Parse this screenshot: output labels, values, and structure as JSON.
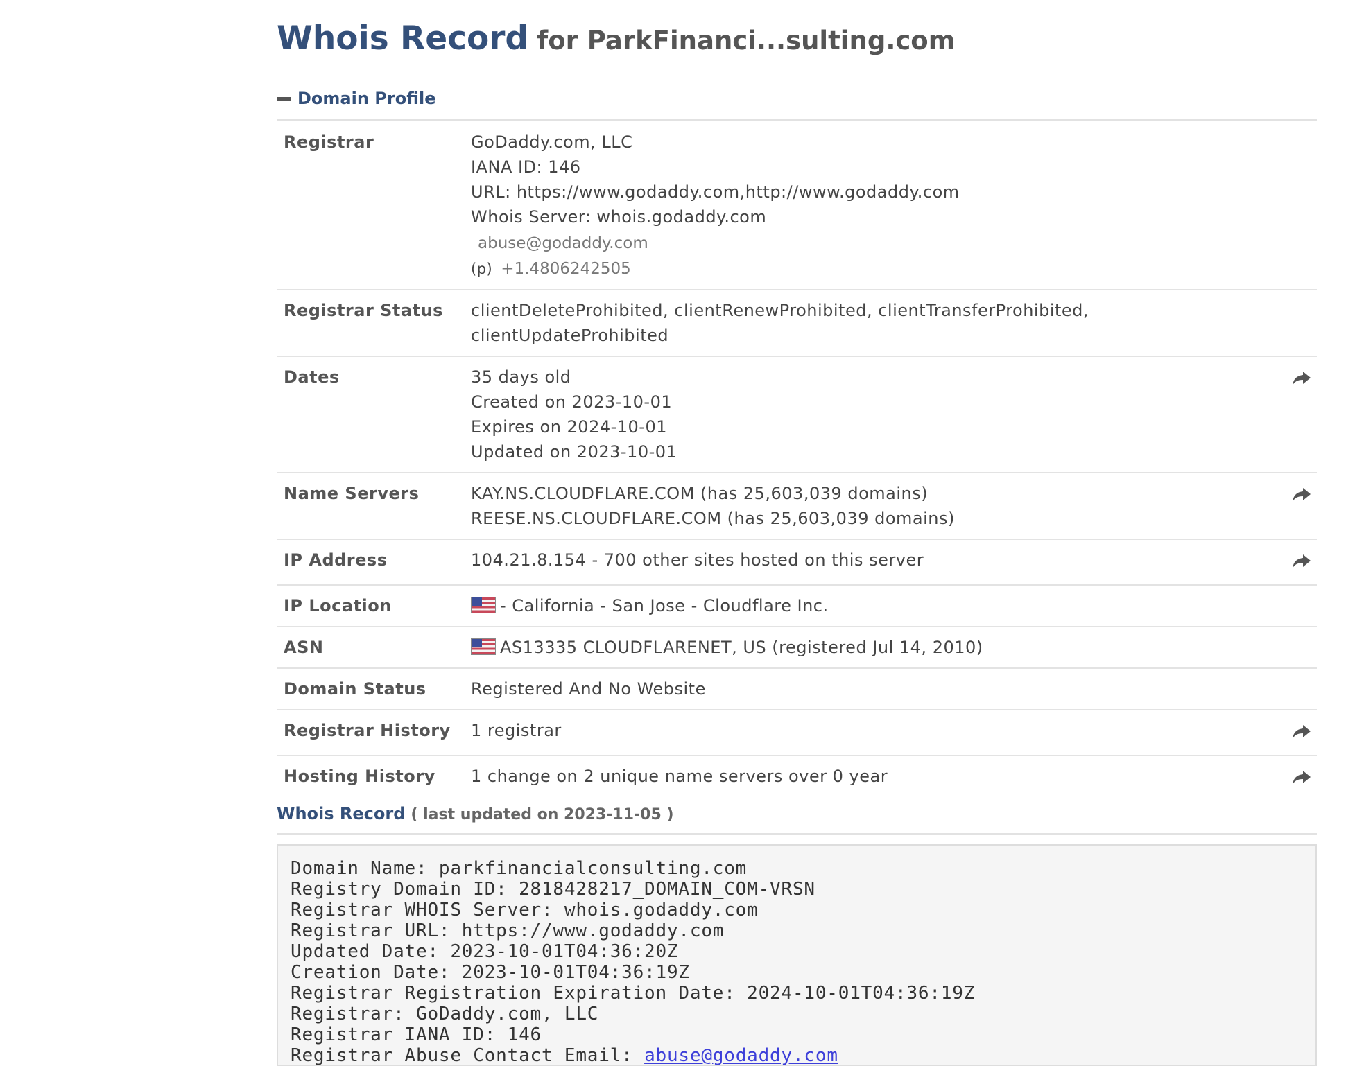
{
  "header": {
    "title": "Whois Record",
    "subtitle": "for ParkFinanci...sulting.com"
  },
  "profile": {
    "heading": "Domain Profile",
    "rows": [
      {
        "label": "Registrar",
        "lines": [
          "GoDaddy.com, LLC",
          "IANA ID: 146",
          "URL: https://www.godaddy.com,http://www.godaddy.com",
          "Whois Server: whois.godaddy.com"
        ],
        "email": "abuse@godaddy.com",
        "phone_prefix": "(p)",
        "phone": "+1.4806242505",
        "share": false
      },
      {
        "label": "Registrar Status",
        "lines": [
          "clientDeleteProhibited, clientRenewProhibited, clientTransferProhibited,",
          "clientUpdateProhibited"
        ],
        "share": false
      },
      {
        "label": "Dates",
        "lines": [
          "35 days old",
          "Created on 2023-10-01",
          "Expires on 2024-10-01",
          "Updated on 2023-10-01"
        ],
        "share": true
      },
      {
        "label": "Name Servers",
        "lines": [
          "KAY.NS.CLOUDFLARE.COM (has 25,603,039 domains)",
          "REESE.NS.CLOUDFLARE.COM (has 25,603,039 domains)"
        ],
        "share": true
      },
      {
        "label": "IP Address",
        "lines": [
          "104.21.8.154 - 700 other sites hosted on this server"
        ],
        "share": true
      },
      {
        "label": "IP Location",
        "lines": [
          "- California - San Jose - Cloudflare Inc."
        ],
        "flag": true,
        "share": false
      },
      {
        "label": "ASN",
        "lines": [
          "AS13335 CLOUDFLARENET, US (registered Jul 14, 2010)"
        ],
        "flag": true,
        "share": false
      },
      {
        "label": "Domain Status",
        "lines": [
          "Registered And No Website"
        ],
        "share": false
      },
      {
        "label": "Registrar History",
        "lines": [
          "1 registrar"
        ],
        "share": true
      },
      {
        "label": "Hosting History",
        "lines": [
          "1 change on 2 unique name servers over 0 year"
        ],
        "share": true
      }
    ]
  },
  "whois_record": {
    "heading": "Whois Record",
    "updated": "( last updated on 2023-11-05 )",
    "lines": [
      "Domain Name: parkfinancialconsulting.com",
      "Registry Domain ID: 2818428217_DOMAIN_COM-VRSN",
      "Registrar WHOIS Server: whois.godaddy.com",
      "Registrar URL: https://www.godaddy.com",
      "Updated Date: 2023-10-01T04:36:20Z",
      "Creation Date: 2023-10-01T04:36:19Z",
      "Registrar Registration Expiration Date: 2024-10-01T04:36:19Z",
      "Registrar: GoDaddy.com, LLC",
      "Registrar IANA ID: 146"
    ],
    "partial_line_prefix": "Registrar Abuse Contact Email: ",
    "partial_line_link": "abuse@godaddy.com"
  }
}
